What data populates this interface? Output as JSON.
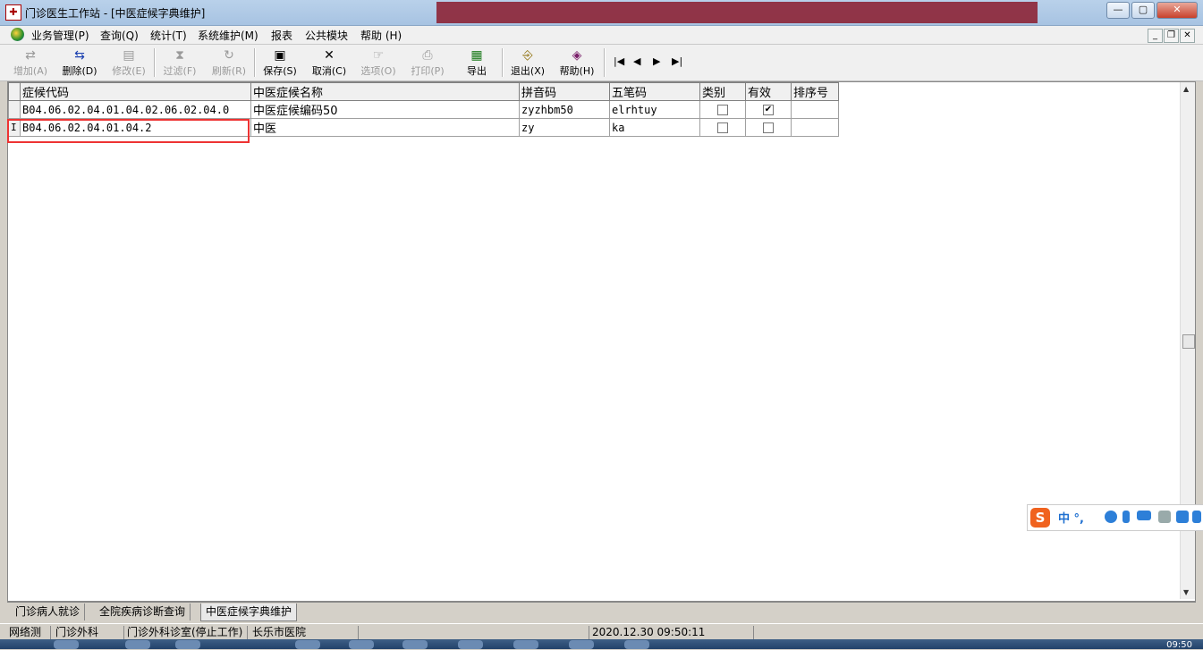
{
  "window": {
    "title": "门诊医生工作站 - [中医症候字典维护]"
  },
  "menu": [
    "业务管理(P)",
    "查询(Q)",
    "统计(T)",
    "系统维护(M)",
    "报表",
    "公共模块",
    "帮助 (H)"
  ],
  "toolbar": {
    "add": "增加(A)",
    "delete": "删除(D)",
    "edit": "修改(E)",
    "filter": "过滤(F)",
    "refresh": "刷新(R)",
    "save": "保存(S)",
    "cancel": "取消(C)",
    "options": "选项(O)",
    "print": "打印(P)",
    "export": "导出",
    "exit": "退出(X)",
    "help": "帮助(H)"
  },
  "grid": {
    "columns": [
      "症候代码",
      "中医症候名称",
      "拼音码",
      "五笔码",
      "类别",
      "有效",
      "排序号"
    ],
    "rows": [
      {
        "code": "B04.06.02.04.01.04.02.06.02.04.0",
        "name": "中医症候编码50",
        "pinyin": "zyzhbm50",
        "wubi": "elrhtuy",
        "category": false,
        "valid": true,
        "order": ""
      },
      {
        "code": "B04.06.02.04.01.04.2",
        "name": "中医",
        "pinyin": "zy",
        "wubi": "ka",
        "category": false,
        "valid": false,
        "order": ""
      }
    ],
    "row_indicator": "I"
  },
  "ime": {
    "logo": "S",
    "label": "中 °,"
  },
  "tabs": [
    "门诊病人就诊",
    "全院疾病诊断查询",
    "中医症候字典维护"
  ],
  "status": {
    "network": "网络测",
    "dept": "门诊外科",
    "room": "门诊外科诊室(停止工作)",
    "hospital": "长乐市医院",
    "datetime": "2020.12.30 09:50:11"
  },
  "taskbar": {
    "clock": "09:50"
  }
}
